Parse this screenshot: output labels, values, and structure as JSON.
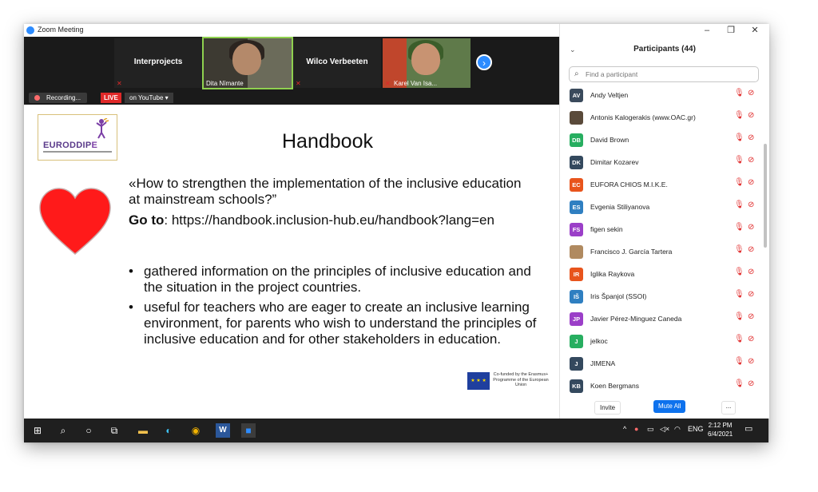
{
  "window": {
    "title": "Zoom Meeting",
    "minimize_glyph": "–",
    "restore_glyph": "❐",
    "close_glyph": "✕"
  },
  "video_strip": {
    "tiles": [
      {
        "name": "Interprojects",
        "has_video": false
      },
      {
        "name": "Dita Nīmante",
        "has_video": true
      },
      {
        "name": "Wilco Verbeeten",
        "has_video": false
      },
      {
        "name": "Karel Van Isa...",
        "has_video": true
      }
    ],
    "next_glyph": "›"
  },
  "status": {
    "recording_label": "Recording...",
    "live_label": "LIVE",
    "stream_label": "on YouTube ▾"
  },
  "slide": {
    "logo_text": "EURODDIP",
    "logo_e": "E",
    "title": "Handbook",
    "intro": "«How to strengthen the implementation of the inclusive education at mainstream schools?”",
    "goto_label": "Go to",
    "goto_url": ": https://handbook.inclusion-hub.eu/handbook?lang=en",
    "bullet_glyph": "•",
    "bullets": [
      "gathered information on the principles of inclusive education and the situation in the project countries.",
      "useful for teachers who are eager to create an inclusive learning environment, for parents who wish to understand the principles of inclusive education and for other stakeholders in education."
    ],
    "eu_text": "Co-funded by the Erasmus+ Programme of the European Union"
  },
  "participants": {
    "title": "Participants (44)",
    "search_placeholder": "Find a participant",
    "list": [
      {
        "initials": "AV",
        "name": "Andy Veltjen",
        "color": "#3a4a5c"
      },
      {
        "initials": "",
        "name": "Antonis Kalogerakis (www.OAC.gr)",
        "color": "#5a4a3a"
      },
      {
        "initials": "DB",
        "name": "David Brown",
        "color": "#27ae60"
      },
      {
        "initials": "DK",
        "name": "Dimitar Kozarev",
        "color": "#34495e"
      },
      {
        "initials": "EC",
        "name": "EUFORA CHIOS M.I.K.E.",
        "color": "#e8541c"
      },
      {
        "initials": "ES",
        "name": "Evgenia Stiliyanova",
        "color": "#2f7fc1"
      },
      {
        "initials": "FS",
        "name": "figen sekin",
        "color": "#9b3fc8"
      },
      {
        "initials": "",
        "name": "Francisco J. García Tartera",
        "color": "#b08a60"
      },
      {
        "initials": "IR",
        "name": "Iglika Raykova",
        "color": "#e8541c"
      },
      {
        "initials": "IŠ",
        "name": "Iris Španjol (SSOI)",
        "color": "#2f7fc1"
      },
      {
        "initials": "JP",
        "name": "Javier Pérez-Minguez Caneda",
        "color": "#9b3fc8"
      },
      {
        "initials": "J",
        "name": "jelkoc",
        "color": "#27ae60"
      },
      {
        "initials": "J",
        "name": "JIMENA",
        "color": "#34495e"
      },
      {
        "initials": "KB",
        "name": "Koen Bergmans",
        "color": "#34495e"
      }
    ],
    "invite_label": "Invite",
    "mute_all_label": "Mute All",
    "more_label": "..."
  },
  "taskbar": {
    "language": "ENG",
    "time": "2:12 PM",
    "date": "6/4/2021"
  },
  "colors": {
    "accent": "#2d8cff",
    "live": "#e02828",
    "muted_red": "#e02828",
    "heart": "#ff1a1a",
    "mute_all_button": "#0e72ed"
  }
}
